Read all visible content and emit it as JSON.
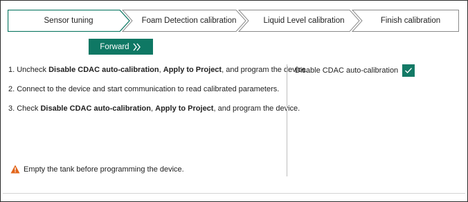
{
  "stepper": {
    "steps": [
      {
        "label": "Sensor tuning",
        "active": true
      },
      {
        "label": "Foam Detection calibration",
        "active": false
      },
      {
        "label": "Liquid Level calibration",
        "active": false
      },
      {
        "label": "Finish calibration",
        "active": false
      }
    ]
  },
  "forward_button": {
    "label": "Forward",
    "icon": "double-chevron-right-icon",
    "color": "#0f7864"
  },
  "instructions": {
    "step1": {
      "prefix": "1. Uncheck ",
      "bold1": "Disable CDAC auto-calibration",
      "mid1": ", ",
      "bold2": "Apply to Project",
      "suffix": ", and program the device."
    },
    "step2": {
      "text": "2. Connect to the device and start communication to read calibrated parameters."
    },
    "step3": {
      "prefix": "3. Check ",
      "bold1": "Disable CDAC auto-calibration",
      "mid1": ", ",
      "bold2": "Apply to Project",
      "suffix": ", and program the device."
    }
  },
  "warning": {
    "icon": "warning-triangle-icon",
    "text": "Empty the tank before programming the device.",
    "color": "#e2651a"
  },
  "option": {
    "label": "Disable CDAC auto-calibration",
    "checked": true,
    "color": "#137a66"
  }
}
